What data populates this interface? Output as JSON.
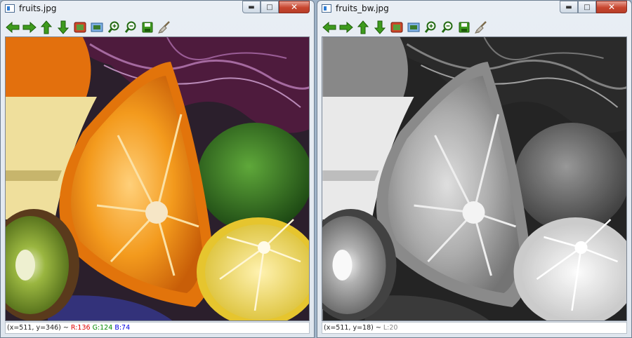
{
  "windows": [
    {
      "title": "fruits.jpg",
      "status": {
        "coords": "(x=511, y=346) ~ ",
        "r": "R:136",
        "g": "G:124",
        "b": "B:74"
      }
    },
    {
      "title": "fruits_bw.jpg",
      "status": {
        "coords": "(x=511, y=18) ~ ",
        "l": "L:20"
      }
    }
  ],
  "window_controls": {
    "minimize": "▬",
    "maximize": "□",
    "close": "✕"
  },
  "toolbar_icons": [
    "arrow-left-icon",
    "arrow-right-icon",
    "arrow-up-icon",
    "arrow-down-icon",
    "image-icon",
    "fit-icon",
    "zoom-in-icon",
    "zoom-out-icon",
    "save-icon",
    "clear-icon"
  ],
  "colors": {
    "red": "#e00000",
    "green": "#008a00",
    "blue": "#0000e0",
    "gray": "#888888"
  }
}
